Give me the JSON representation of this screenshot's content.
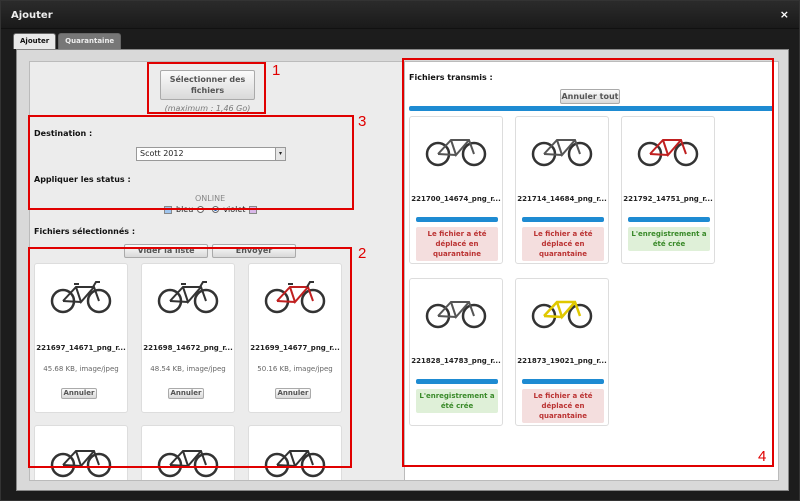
{
  "window": {
    "title": "Ajouter",
    "close_label": "×"
  },
  "tabs": [
    {
      "label": "Ajouter"
    },
    {
      "label": "Quarantaine"
    }
  ],
  "left": {
    "select_button_label_1": "Sélectionner des",
    "select_button_label_2": "fichiers",
    "max_note": "(maximum : 1,46 Go)",
    "destination_label": "Destination :",
    "destination_value": "Scott 2012",
    "status_label": "Appliquer les status :",
    "online_label": "ONLINE",
    "status_options": [
      {
        "label": "bleu",
        "color": "#9fc5ee"
      },
      {
        "label": "violet",
        "color": "#d8b8e8"
      }
    ],
    "selected_files_label": "Fichiers sélectionnés :",
    "clear_button": "Vider la liste",
    "send_button": "Envoyer",
    "files": [
      {
        "name": "221697_14671_png_r...",
        "meta": "45.68 KB, image/jpeg",
        "cancel": "Annuler",
        "accent": "#333"
      },
      {
        "name": "221698_14672_png_r...",
        "meta": "48.54 KB, image/jpeg",
        "cancel": "Annuler",
        "accent": "#333"
      },
      {
        "name": "221699_14677_png_r...",
        "meta": "50.16 KB, image/jpeg",
        "cancel": "Annuler",
        "accent": "#c02020"
      },
      {
        "name": "",
        "meta": "",
        "cancel": "",
        "accent": "#333"
      },
      {
        "name": "",
        "meta": "",
        "cancel": "",
        "accent": "#333"
      },
      {
        "name": "",
        "meta": "",
        "cancel": "",
        "accent": "#333"
      }
    ]
  },
  "right": {
    "sent_label": "Fichiers transmis :",
    "cancel_all": "Annuler tout",
    "files": [
      {
        "name": "221700_14674_png_r...",
        "status": "Le fichier a été déplacé en quarantaine",
        "kind": "err",
        "accent": "#333"
      },
      {
        "name": "221714_14684_png_r...",
        "status": "Le fichier a été déplacé en quarantaine",
        "kind": "err",
        "accent": "#333"
      },
      {
        "name": "221792_14751_png_r...",
        "status": "L'enregistrement a été crée",
        "kind": "ok",
        "accent": "#c02020"
      },
      {
        "name": "221828_14783_png_r...",
        "status": "L'enregistrement a été crée",
        "kind": "ok",
        "accent": "#333"
      },
      {
        "name": "221873_19021_png_r...",
        "status": "Le fichier a été déplacé en quarantaine",
        "kind": "err",
        "accent": "#e0c800"
      }
    ]
  },
  "annotations": [
    {
      "num": "1"
    },
    {
      "num": "2"
    },
    {
      "num": "3"
    },
    {
      "num": "4"
    }
  ]
}
